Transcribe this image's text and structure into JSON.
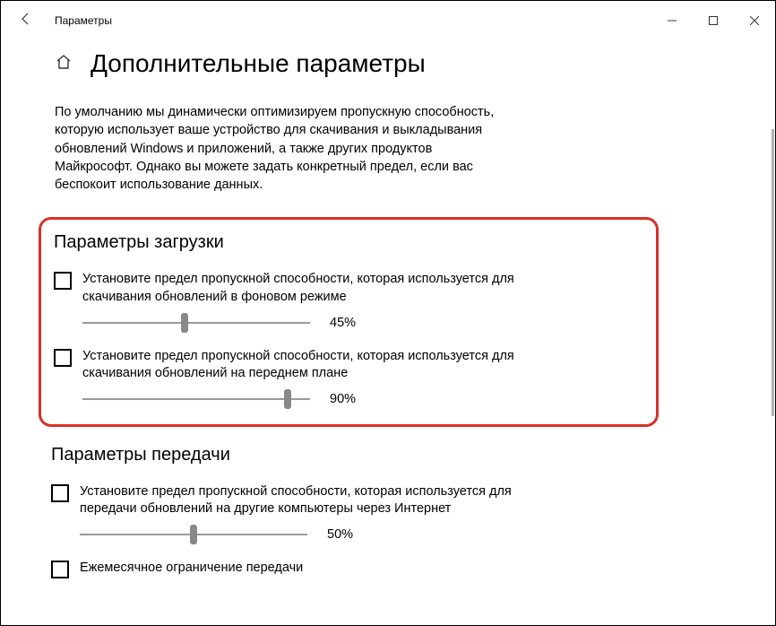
{
  "window": {
    "title": "Параметры"
  },
  "page": {
    "heading": "Дополнительные параметры",
    "description": "По умолчанию мы динамически оптимизируем пропускную способность, которую использует ваше устройство для скачивания и выкладывания обновлений Windows и приложений, а также других продуктов Майкрософт. Однако вы можете задать конкретный предел, если вас беспокоит использование данных."
  },
  "download": {
    "section_title": "Параметры загрузки",
    "background_limit_label": "Установите предел пропускной способности, которая используется для скачивания обновлений в фоновом режиме",
    "background_limit_value": "45%",
    "background_limit_pos": 45,
    "foreground_limit_label": "Установите предел пропускной способности, которая используется для скачивания обновлений на переднем плане",
    "foreground_limit_value": "90%",
    "foreground_limit_pos": 90
  },
  "upload": {
    "section_title": "Параметры передачи",
    "upload_limit_label": "Установите предел пропускной способности, которая используется для передачи обновлений на другие компьютеры через Интернет",
    "upload_limit_value": "50%",
    "upload_limit_pos": 50,
    "monthly_limit_label": "Ежемесячное ограничение передачи"
  }
}
